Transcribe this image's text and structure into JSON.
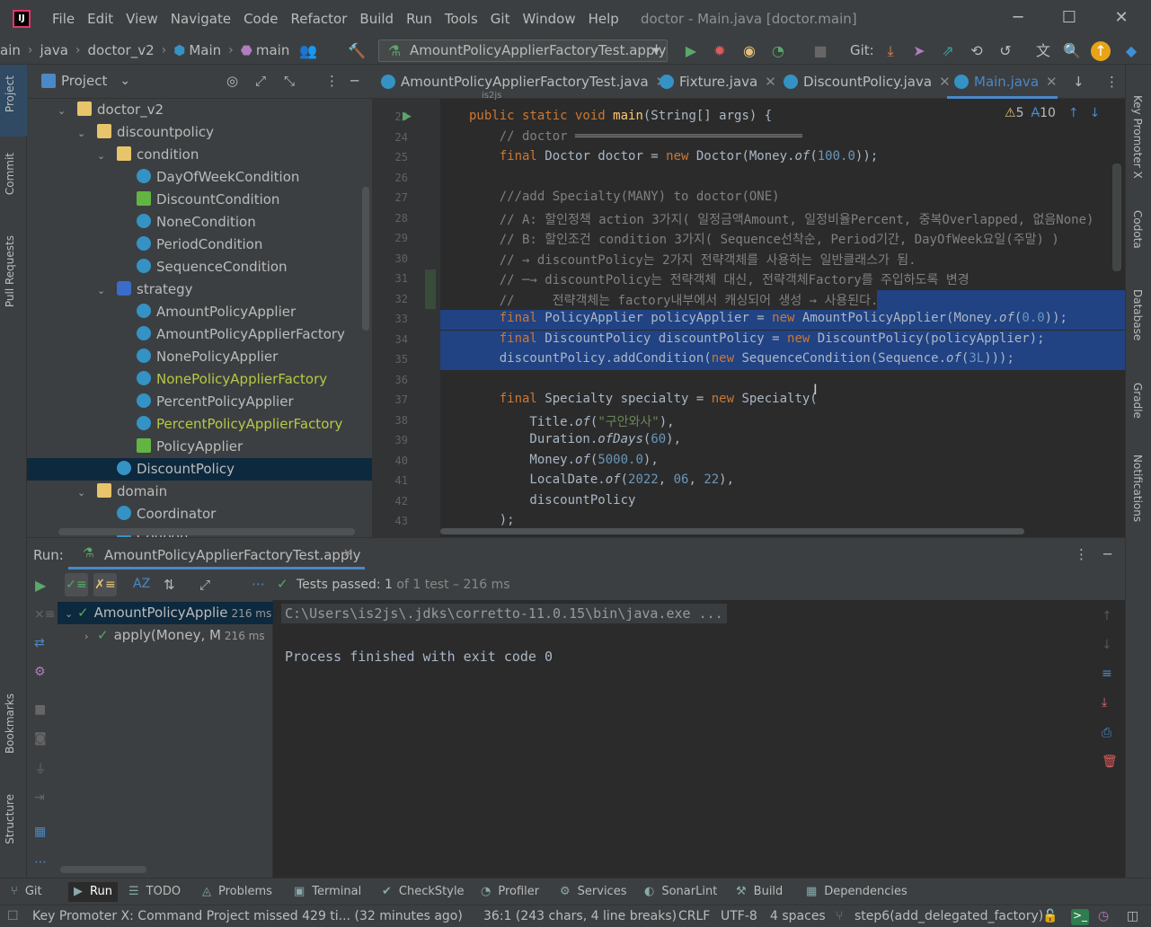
{
  "app": {
    "window_title": "doctor - Main.java [doctor.main]",
    "logo": "IJ"
  },
  "menu": [
    "File",
    "Edit",
    "View",
    "Navigate",
    "Code",
    "Refactor",
    "Build",
    "Run",
    "Tools",
    "Git",
    "Window",
    "Help"
  ],
  "breadcrumb": [
    "ain",
    "java",
    "doctor_v2",
    "Main",
    "main"
  ],
  "run_config": "AmountPolicyApplierFactoryTest.apply",
  "git_label": "Git:",
  "left_strip": [
    "Project",
    "Commit",
    "Pull Requests",
    "Bookmarks",
    "Structure"
  ],
  "right_strip": [
    "Key Promoter X",
    "Codota",
    "Database",
    "Gradle",
    "Notifications"
  ],
  "project": {
    "header": "Project",
    "items": [
      {
        "label": "doctor_v2",
        "type": "folder",
        "depth": 2,
        "chev": "down"
      },
      {
        "label": "discountpolicy",
        "type": "folder",
        "depth": 3,
        "chev": "down"
      },
      {
        "label": "condition",
        "type": "folder",
        "depth": 4,
        "chev": "down"
      },
      {
        "label": "DayOfWeekCondition",
        "type": "class",
        "depth": 5
      },
      {
        "label": "DiscountCondition",
        "type": "iface",
        "depth": 5
      },
      {
        "label": "NoneCondition",
        "type": "class",
        "depth": 5
      },
      {
        "label": "PeriodCondition",
        "type": "class",
        "depth": 5
      },
      {
        "label": "SequenceCondition",
        "type": "class",
        "depth": 5
      },
      {
        "label": "strategy",
        "type": "pkg",
        "depth": 4,
        "chev": "down"
      },
      {
        "label": "AmountPolicyApplier",
        "type": "class",
        "depth": 5
      },
      {
        "label": "AmountPolicyApplierFactory",
        "type": "class",
        "depth": 5
      },
      {
        "label": "NonePolicyApplier",
        "type": "class",
        "depth": 5
      },
      {
        "label": "NonePolicyApplierFactory",
        "type": "class",
        "depth": 5,
        "color": "#b5c945"
      },
      {
        "label": "PercentPolicyApplier",
        "type": "class",
        "depth": 5
      },
      {
        "label": "PercentPolicyApplierFactory",
        "type": "class",
        "depth": 5,
        "color": "#b5c945"
      },
      {
        "label": "PolicyApplier",
        "type": "iface",
        "depth": 5
      },
      {
        "label": "DiscountPolicy",
        "type": "class",
        "depth": 4,
        "selected": true
      },
      {
        "label": "domain",
        "type": "folder",
        "depth": 3,
        "chev": "down"
      },
      {
        "label": "Coordinator",
        "type": "class",
        "depth": 4
      },
      {
        "label": "Coupon",
        "type": "class",
        "depth": 4
      }
    ]
  },
  "tabs": [
    {
      "label": "AmountPolicyApplierFactoryTest.java"
    },
    {
      "label": "Fixture.java"
    },
    {
      "label": "DiscountPolicy.java"
    },
    {
      "label": "Main.java",
      "active": true
    }
  ],
  "editor": {
    "author_hint": "is2js",
    "warnings": "5",
    "typos": "10",
    "lines": [
      {
        "n": "23",
        "html": "<span class='kw'>public static void </span><span class='fn'>main</span>(String[] args) {"
      },
      {
        "n": "24",
        "html": "    <span class='cm'>// doctor ══════════════════════════════</span>"
      },
      {
        "n": "25",
        "html": "    <span class='kw'>final </span>Doctor doctor = <span class='kw'>new </span>Doctor(Money.<span class='it'>of</span>(<span class='num'>100.0</span>));"
      },
      {
        "n": "26",
        "html": ""
      },
      {
        "n": "27",
        "html": "    <span class='cm'>///add Specialty(MANY) to doctor(ONE)</span>"
      },
      {
        "n": "28",
        "html": "    <span class='cm'>// A: 할인정책 action 3가지( 일정금액Amount, 일정비율Percent, 중복Overlapped, 없음None)</span>"
      },
      {
        "n": "29",
        "html": "    <span class='cm'>// B: 할인조건 condition 3가지( Sequence선착순, Period기간, DayOfWeek요일(주말) )</span>"
      },
      {
        "n": "30",
        "html": "    <span class='cm'>// → discountPolicy는 2가지 전략객체를 사용하는 일반클래스가 됨.</span>"
      },
      {
        "n": "31",
        "html": "    <span class='cm'>// ─→ discountPolicy는 전략객체 대신, 전략객체Factory를 주입하도록 변경</span>"
      },
      {
        "n": "32",
        "html": "    <span class='cm'>//     전략객체는 factory내부에서 캐싱되어 생성 → 사용된다.</span>"
      },
      {
        "n": "33",
        "html": "    <span class='kw'>final </span>PolicyApplier policyApplier = <span class='kw'>new </span>AmountPolicyApplier(Money.<span class='it'>of</span>(<span class='num'>0.0</span>));"
      },
      {
        "n": "34",
        "html": "    <span class='kw'>final </span>DiscountPolicy discountPolicy = <span class='kw'>new </span>DiscountPolicy(policyApplier);"
      },
      {
        "n": "35",
        "html": "    discountPolicy.addCondition(<span class='kw'>new </span>SequenceCondition(Sequence.<span class='it'>of</span>(<span class='num'>3L</span>)));"
      },
      {
        "n": "36",
        "html": ""
      },
      {
        "n": "37",
        "html": "    <span class='kw'>final </span>Specialty specialty = <span class='kw'>new </span>Specialty("
      },
      {
        "n": "38",
        "html": "        Title.<span class='it'>of</span>(<span class='str'>\"구안와사\"</span>),"
      },
      {
        "n": "39",
        "html": "        Duration.<span class='it'>ofDays</span>(<span class='num'>60</span>),"
      },
      {
        "n": "40",
        "html": "        Money.<span class='it'>of</span>(<span class='num'>5000.0</span>),"
      },
      {
        "n": "41",
        "html": "        LocalDate.<span class='it'>of</span>(<span class='num'>2022</span>, <span class='num'>06</span>, <span class='num'>22</span>),"
      },
      {
        "n": "42",
        "html": "        discountPolicy"
      },
      {
        "n": "43",
        "html": "    );"
      }
    ]
  },
  "run": {
    "label": "Run:",
    "tab": "AmountPolicyApplierFactoryTest.apply",
    "status_bold": "Tests passed: 1",
    "status_rest": "of 1 test – 216 ms",
    "tree": [
      {
        "label": "AmountPolicyApplie",
        "time": "216 ms",
        "depth": 0
      },
      {
        "label": "apply(Money, M",
        "time": "216 ms",
        "depth": 1
      }
    ],
    "console": [
      "C:\\Users\\is2js\\.jdks\\corretto-11.0.15\\bin\\java.exe ...",
      "",
      "Process finished with exit code 0"
    ]
  },
  "tool_tabs": [
    "Git",
    "Run",
    "TODO",
    "Problems",
    "Terminal",
    "CheckStyle",
    "Profiler",
    "Services",
    "SonarLint",
    "Build",
    "Dependencies"
  ],
  "status": {
    "message": "Key Promoter X: Command Project missed 429 ti... (32 minutes ago)",
    "position": "36:1 (243 chars, 4 line breaks)",
    "line_sep": "CRLF",
    "encoding": "UTF-8",
    "indent": "4 spaces",
    "branch": "step6(add_delegated_factory)"
  }
}
